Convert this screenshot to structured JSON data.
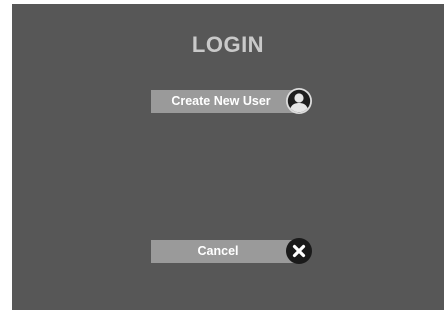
{
  "dialog": {
    "title": "LOGIN"
  },
  "buttons": {
    "create_new_user": {
      "label": "Create New User",
      "icon": "user-icon"
    },
    "cancel": {
      "label": "Cancel",
      "icon": "close-icon"
    }
  },
  "colors": {
    "background": "#575757",
    "title": "#c9c9c9",
    "button_bar": "#9a9a9a",
    "button_text": "#ffffff",
    "icon_dark": "#1a1a1a"
  }
}
